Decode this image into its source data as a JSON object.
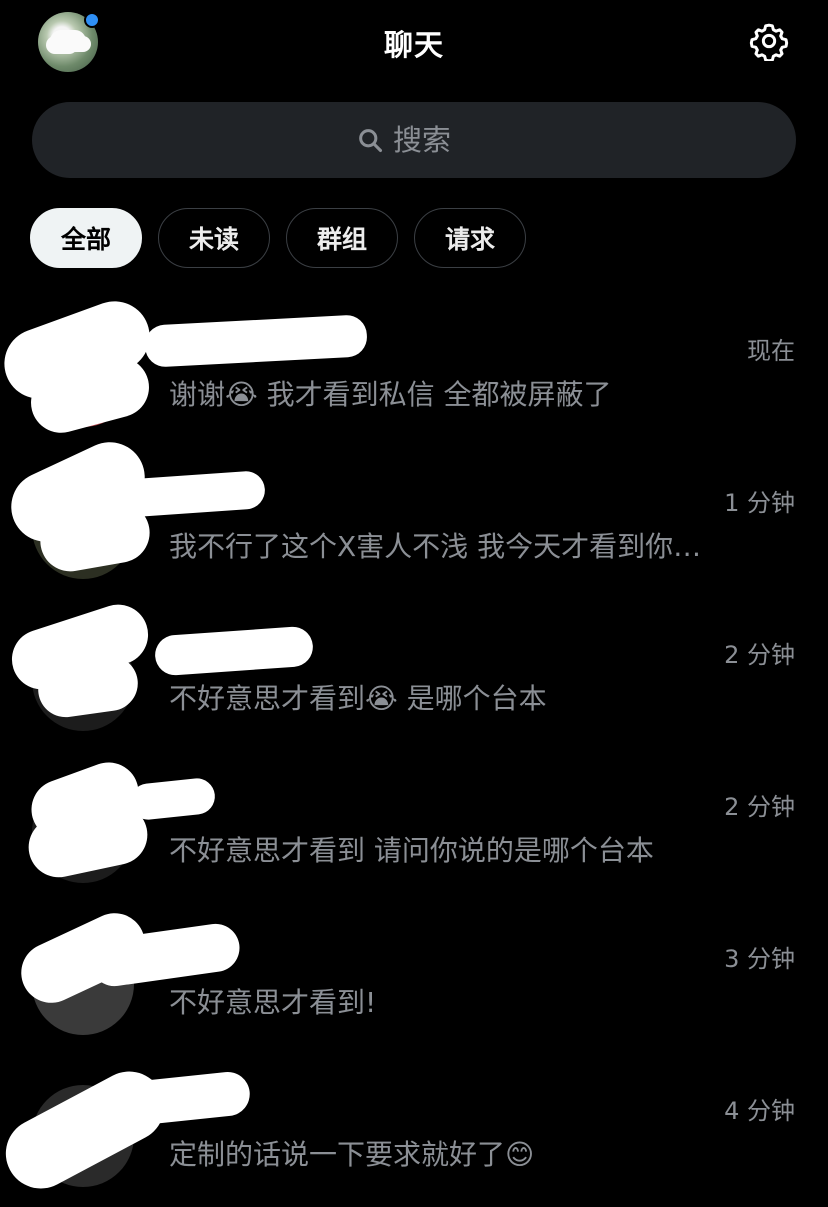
{
  "header": {
    "title": "聊天",
    "settings_icon": "gear-icon",
    "online_color": "#2f8ff5"
  },
  "search": {
    "placeholder": "搜索",
    "icon": "search-icon"
  },
  "tabs": [
    {
      "label": "全部",
      "active": true
    },
    {
      "label": "未读",
      "active": false
    },
    {
      "label": "群组",
      "active": false
    },
    {
      "label": "请求",
      "active": false
    }
  ],
  "conversations": [
    {
      "time": "现在",
      "preview": "谢谢😭 我才看到私信 全都被屏蔽了"
    },
    {
      "time": "1 分钟",
      "preview": "我不行了这个X害人不浅 我今天才看到你…"
    },
    {
      "time": "2 分钟",
      "preview": "不好意思才看到😭 是哪个台本"
    },
    {
      "time": "2 分钟",
      "preview": "不好意思才看到 请问你说的是哪个台本"
    },
    {
      "time": "3 分钟",
      "preview": "不好意思才看到!"
    },
    {
      "time": "4 分钟",
      "preview": "定制的话说一下要求就好了😊"
    }
  ]
}
